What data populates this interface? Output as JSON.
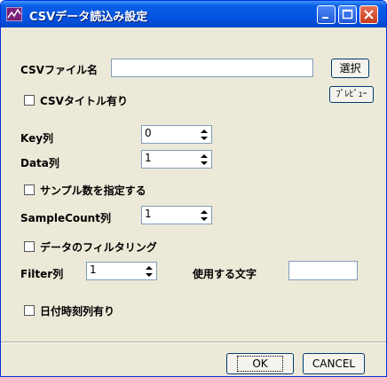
{
  "window": {
    "title": "CSVデータ読込み設定"
  },
  "csv_file": {
    "label": "CSVファイル名",
    "value": "",
    "browse_label": "選択",
    "preview_label": "ﾌﾟﾚﾋﾞｭｰ"
  },
  "csv_title": {
    "label": "CSVタイトル有り",
    "checked": false
  },
  "key_col": {
    "label": "Key列",
    "value": "0"
  },
  "data_col": {
    "label": "Data列",
    "value": "1"
  },
  "sample_spec": {
    "label": "サンプル数を指定する",
    "checked": false
  },
  "sample_count": {
    "label": "SampleCount列",
    "value": "1"
  },
  "data_filter": {
    "label": "データのフィルタリング",
    "checked": false
  },
  "filter_col": {
    "label": "Filter列",
    "value": "1"
  },
  "filter_chars": {
    "label": "使用する文字",
    "value": ""
  },
  "date_col": {
    "label": "日付時刻列有り",
    "checked": false
  },
  "buttons": {
    "ok": "OK",
    "cancel": "CANCEL"
  }
}
